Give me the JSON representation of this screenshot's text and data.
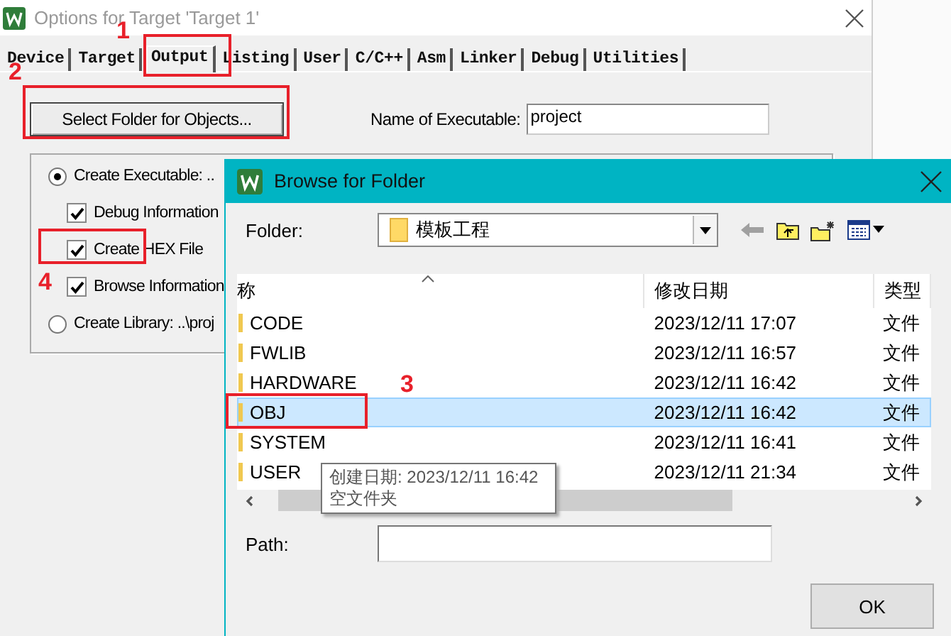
{
  "options_window": {
    "title": "Options for Target 'Target 1'",
    "tabs": [
      {
        "label": "Device",
        "selected": false
      },
      {
        "label": "Target",
        "selected": false
      },
      {
        "label": "Output",
        "selected": true
      },
      {
        "label": "Listing",
        "selected": false
      },
      {
        "label": "User",
        "selected": false
      },
      {
        "label": "C/C++",
        "selected": false
      },
      {
        "label": "Asm",
        "selected": false
      },
      {
        "label": "Linker",
        "selected": false
      },
      {
        "label": "Debug",
        "selected": false
      },
      {
        "label": "Utilities",
        "selected": false
      }
    ],
    "select_folder_button": "Select Folder for Objects...",
    "name_label": "Name of Executable:",
    "name_value": "project",
    "output_options": [
      {
        "kind": "radio",
        "label": "Create Executable:  ..",
        "selected": true
      },
      {
        "kind": "checkbox",
        "label": "Debug Information",
        "checked": true
      },
      {
        "kind": "checkbox",
        "label": "Create HEX File",
        "checked": true
      },
      {
        "kind": "checkbox",
        "label": "Browse Information",
        "checked": true
      },
      {
        "kind": "radio",
        "label": "Create Library:  ..\\proj",
        "selected": false
      }
    ]
  },
  "browse_window": {
    "title": "Browse for Folder",
    "folder_label": "Folder:",
    "folder_value": "模板工程",
    "columns": [
      "称",
      "修改日期",
      "类型"
    ],
    "rows": [
      {
        "name": "CODE",
        "date": "2023/12/11 17:07",
        "type": "文件",
        "selected": false
      },
      {
        "name": "FWLIB",
        "date": "2023/12/11 16:57",
        "type": "文件",
        "selected": false
      },
      {
        "name": "HARDWARE",
        "date": "2023/12/11 16:42",
        "type": "文件",
        "selected": false
      },
      {
        "name": "OBJ",
        "date": "2023/12/11 16:42",
        "type": "文件",
        "selected": true
      },
      {
        "name": "SYSTEM",
        "date": "2023/12/11 16:41",
        "type": "文件",
        "selected": false
      },
      {
        "name": "USER",
        "date": "2023/12/11 21:34",
        "type": "文件",
        "selected": false
      }
    ],
    "tooltip": [
      "创建日期: 2023/12/11 16:42",
      "空文件夹"
    ],
    "path_label": "Path:",
    "ok_button": "OK"
  },
  "annotations": [
    "1",
    "2",
    "3",
    "4"
  ]
}
